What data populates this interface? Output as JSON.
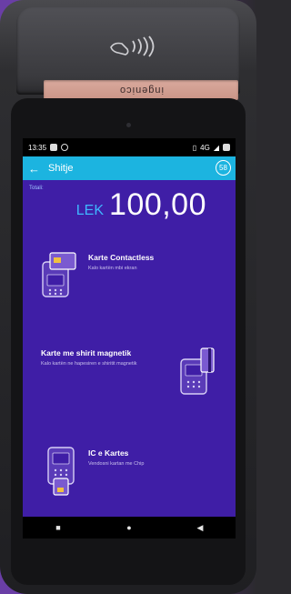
{
  "device": {
    "brand": "ingenico",
    "nfc_symbol": "contactless-icon"
  },
  "status_bar": {
    "time": "13:35",
    "right_text": "4G"
  },
  "app_bar": {
    "title": "Shitje",
    "timer": "58",
    "back_icon": "back-arrow-icon"
  },
  "payment": {
    "total_label": "Totali:",
    "currency": "LEK",
    "amount": "100,00"
  },
  "options": [
    {
      "title": "Karte Contactless",
      "description": "Kalo kartën mbi ekran",
      "icon": "contactless-card-icon"
    },
    {
      "title": "Karte me shirit magnetik",
      "description": "Kalo kartën ne hapesiren e shiritit magnetik",
      "icon": "magstripe-card-icon"
    },
    {
      "title": "IC e Kartes",
      "description": "Vendosni kartan me Chip",
      "icon": "chip-card-icon"
    }
  ],
  "nav": {
    "recent": "■",
    "home": "●",
    "back": "◀"
  },
  "colors": {
    "app_bar": "#1cb4e0",
    "content_bg": "#3f1ea6",
    "currency": "#3fb6ff"
  }
}
